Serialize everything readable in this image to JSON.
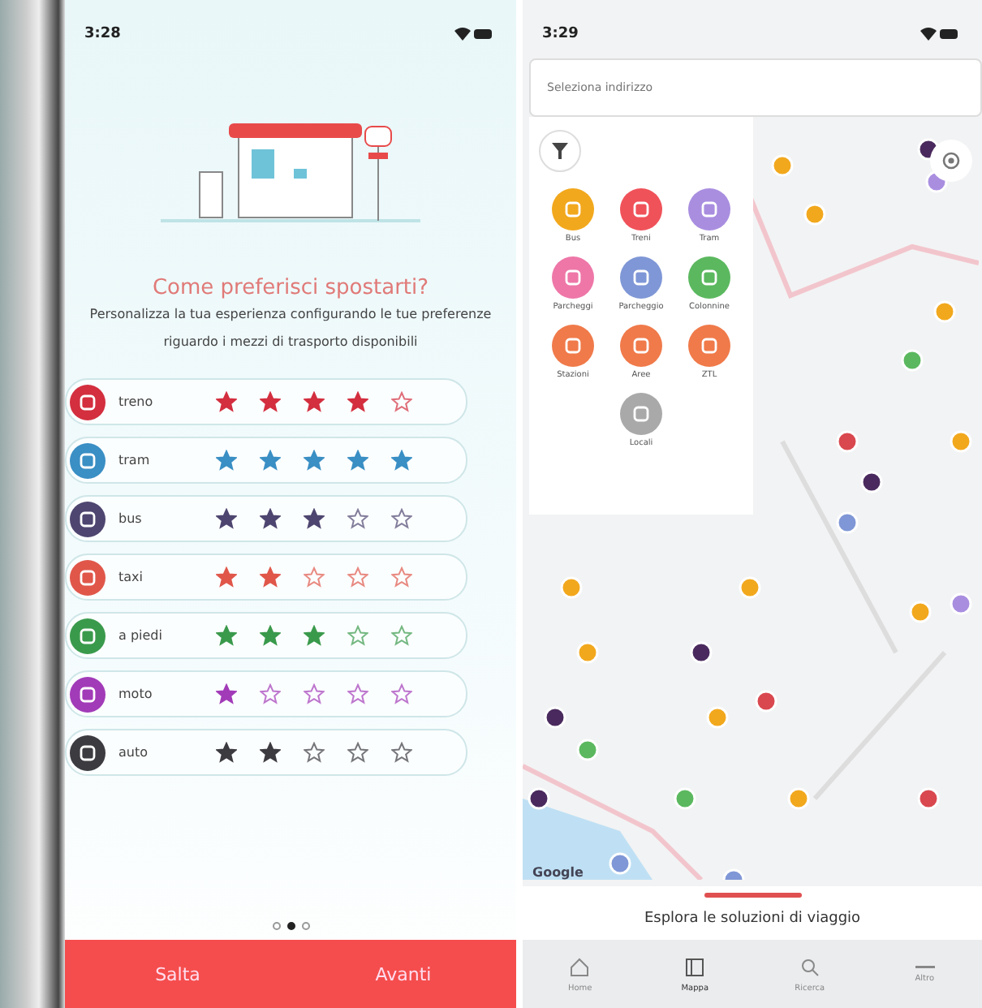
{
  "preferences_screen": {
    "status_time": "3:28",
    "title": "Come preferisci spostarti?",
    "subtitle": "Personalizza la tua esperienza configurando le tue preferenze riguardo i mezzi di trasporto disponibili",
    "modes": [
      {
        "label": "treno",
        "color": "#d32f3f",
        "stars": 4
      },
      {
        "label": "tram",
        "color": "#3a8fc4",
        "stars": 5
      },
      {
        "label": "bus",
        "color": "#4e4670",
        "stars": 3
      },
      {
        "label": "taxi",
        "color": "#e0574a",
        "stars": 2
      },
      {
        "label": "a piedi",
        "color": "#3a9a4c",
        "stars": 3
      },
      {
        "label": "moto",
        "color": "#a23bb8",
        "stars": 1
      },
      {
        "label": "auto",
        "color": "#3b3b40",
        "stars": 2
      }
    ],
    "pages": [
      {
        "selected": false
      },
      {
        "selected": true
      },
      {
        "selected": false
      }
    ],
    "skip_button": "Salta",
    "next_button": "Avanti"
  },
  "map_screen": {
    "status_time": "3:29",
    "search": {
      "placeholder": "Seleziona indirizzo"
    },
    "filters": [
      {
        "label": "Bus",
        "color": "#f2a81d"
      },
      {
        "label": "Treni",
        "color": "#f0525a"
      },
      {
        "label": "Tram",
        "color": "#a98ee0"
      },
      {
        "label": "Parcheggi",
        "color": "#ee77a8"
      },
      {
        "label": "Parcheggio",
        "color": "#7f97d6"
      },
      {
        "label": "Colonnine",
        "color": "#5bb85f"
      },
      {
        "label": "Stazioni",
        "color": "#f07a4a"
      },
      {
        "label": "Aree",
        "color": "#f07a4a"
      },
      {
        "label": "ZTL",
        "color": "#f07a4a"
      },
      {
        "label": "Locali",
        "color": "#a9a9a9"
      }
    ],
    "map_credit": "Google",
    "explore_label": "Esplora le soluzioni di viaggio",
    "tabs": [
      {
        "label": "Home",
        "selected": false
      },
      {
        "label": "Mappa",
        "selected": true
      },
      {
        "label": "Ricerca",
        "selected": false
      },
      {
        "label": "Altro",
        "selected": false
      }
    ]
  }
}
